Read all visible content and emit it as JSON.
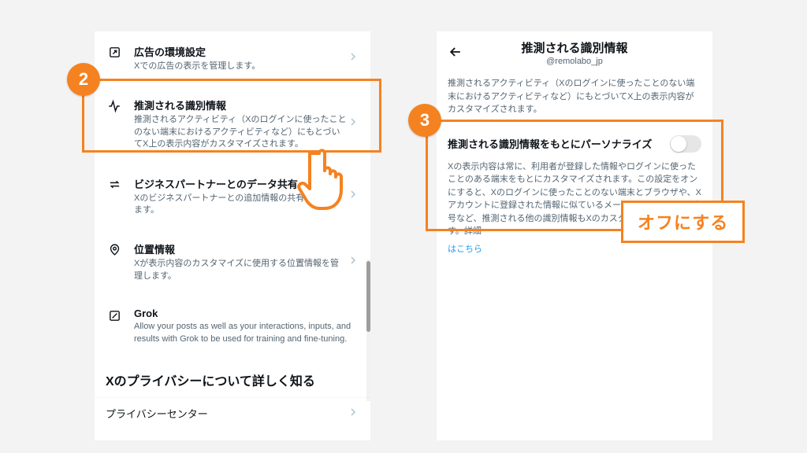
{
  "steps": {
    "badge2": "2",
    "badge3": "3"
  },
  "callout": {
    "text": "オフにする"
  },
  "left": {
    "items": [
      {
        "title": "広告の環境設定",
        "desc": "Xでの広告の表示を管理します。"
      },
      {
        "title": "推測される識別情報",
        "desc": "推測されるアクティビティ（Xのログインに使ったことのない端末におけるアクティビティなど）にもとづいてX上の表示内容がカスタマイズされます。"
      },
      {
        "title": "ビジネスパートナーとのデータ共有",
        "desc": "Xのビジネスパートナーとの追加情報の共有を許可します。"
      },
      {
        "title": "位置情報",
        "desc": "Xが表示内容のカスタマイズに使用する位置情報を管理します。"
      },
      {
        "title": "Grok",
        "desc": "Allow your posts as well as your interactions, inputs, and results with Grok to be used for training and fine-tuning."
      }
    ],
    "section_heading": "Xのプライバシーについて詳しく知る",
    "privacy_center": "プライバシーセンター"
  },
  "right": {
    "header_title": "推測される識別情報",
    "username": "@remolabo_jp",
    "intro": "推測されるアクティビティ（Xのログインに使ったことのない端末におけるアクティビティなど）にもとづいてX上の表示内容がカスタマイズされます。",
    "toggle_label": "推測される識別情報をもとにパーソナライズ",
    "toggle_desc": "Xの表示内容は常に、利用者が登録した情報やログインに使ったことのある端末をもとにカスタマイズされます。この設定をオンにすると、Xのログインに使ったことのない端末とブラウザや、Xアカウントに登録された情報に似ているメールアドレスと電話番号など、推測される他の識別情報もXのカスタマイズに使われます。詳細",
    "link_text": "はこちら"
  }
}
